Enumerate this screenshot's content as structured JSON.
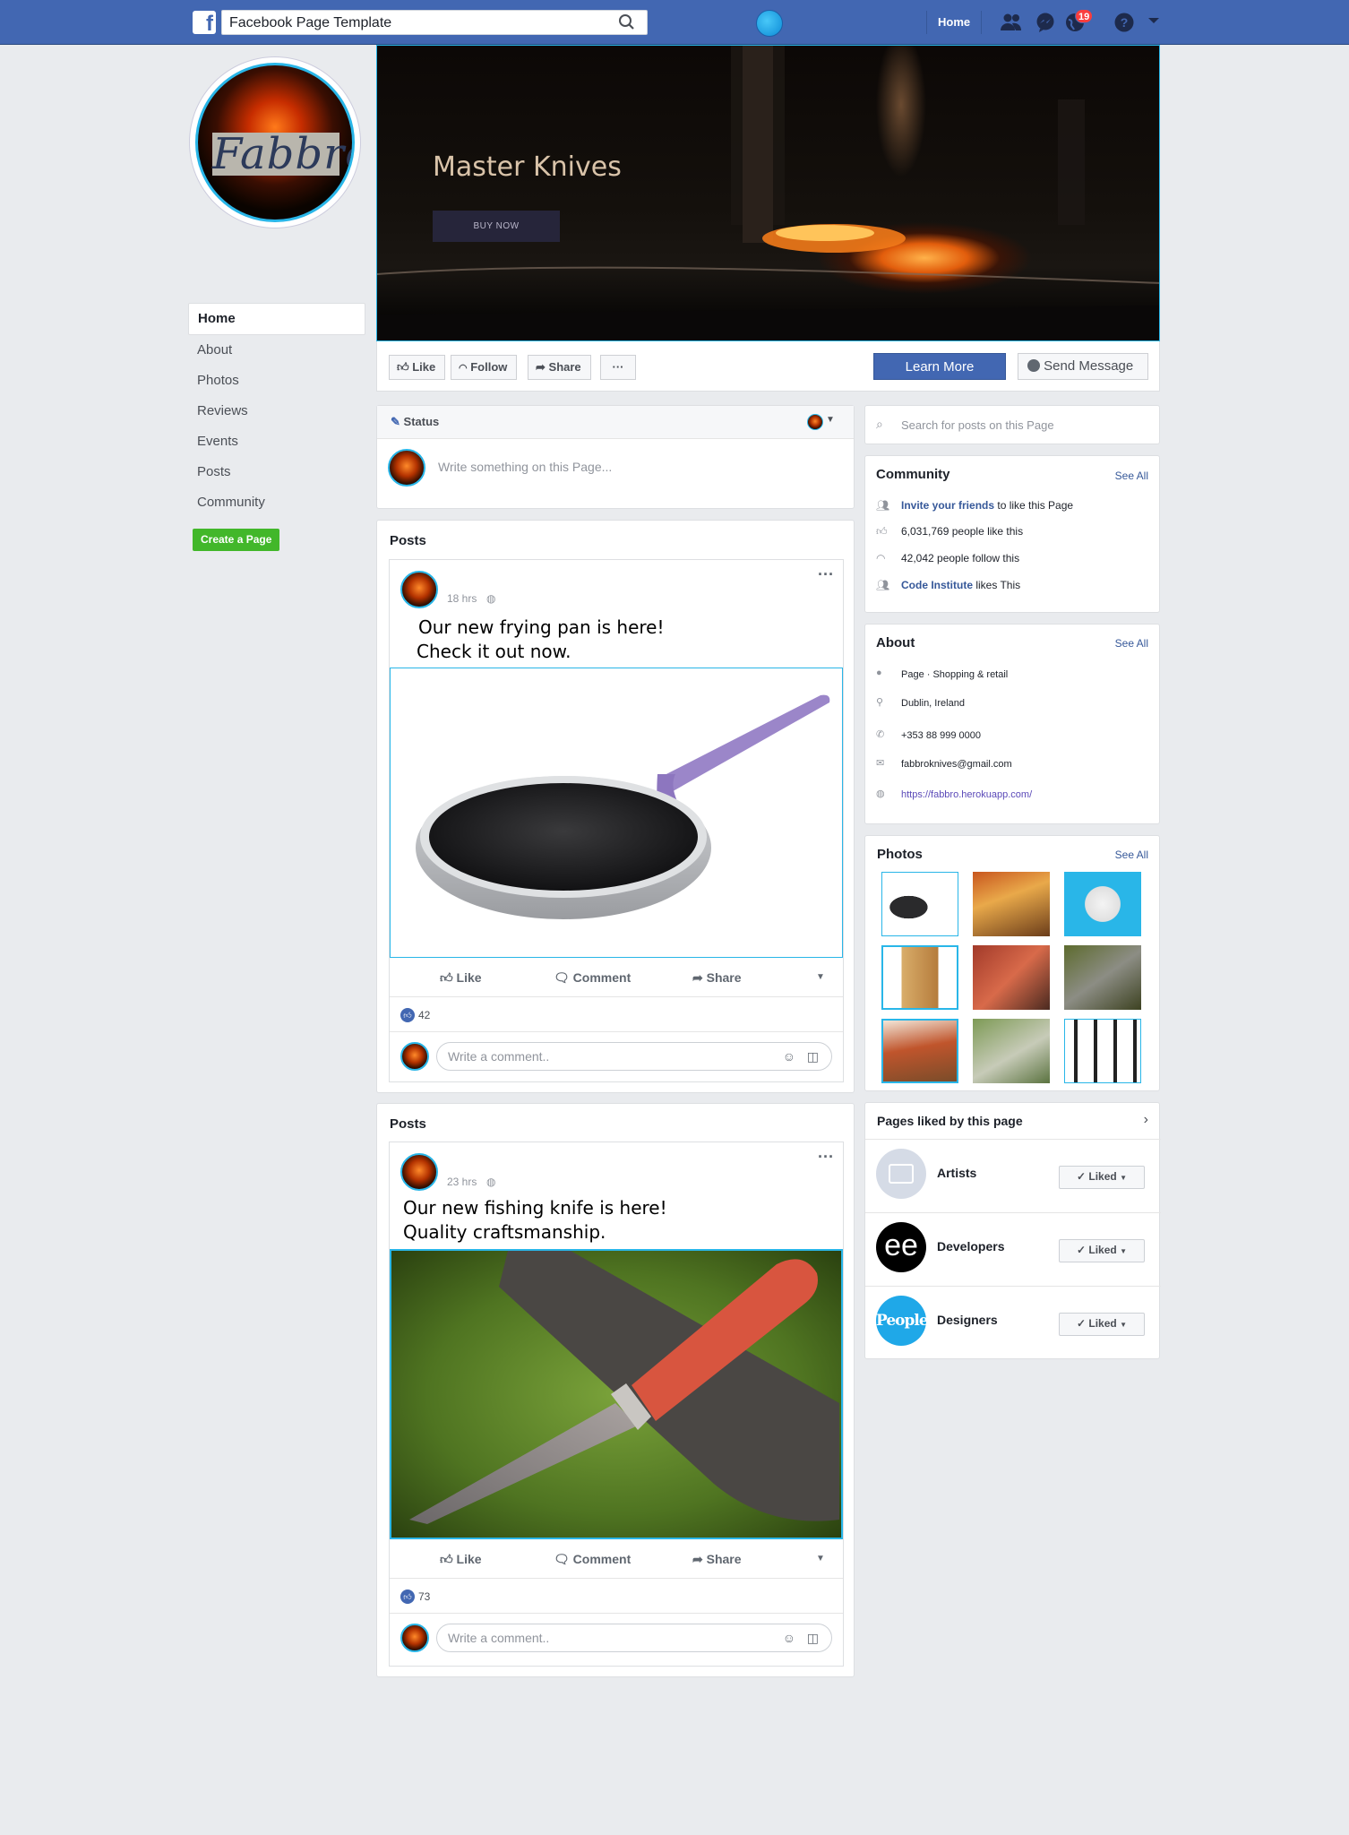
{
  "topbar": {
    "search_value": "Facebook Page Template",
    "home_label": "Home",
    "notification_count": "19",
    "brand_color": "#4267b2"
  },
  "profile": {
    "logo_text": "Fabbro"
  },
  "leftnav": {
    "items": [
      "Home",
      "About",
      "Photos",
      "Reviews",
      "Events",
      "Posts",
      "Community"
    ],
    "create_page": "Create a Page"
  },
  "cover": {
    "title": "Master Knives",
    "button": "BUY NOW"
  },
  "actions": {
    "like": "Like",
    "follow": "Follow",
    "share": "Share",
    "more": "···",
    "learn_more": "Learn More",
    "send_message": "Send Message"
  },
  "status": {
    "tab": "Status",
    "placeholder": "Write something on this Page..."
  },
  "posts": [
    {
      "section_title": "Posts",
      "time": "18 hrs",
      "text_line1": "Our new frying pan is here!",
      "text_line2": "Check it out now.",
      "like": "Like",
      "comment": "Comment",
      "share": "Share",
      "reactions": "42",
      "comment_placeholder": "Write a comment.."
    },
    {
      "section_title": "Posts",
      "time": "23 hrs",
      "text_line1": "Our new fishing knife is here!",
      "text_line2": "Quality craftsmanship.",
      "like": "Like",
      "comment": "Comment",
      "share": "Share",
      "reactions": "73",
      "comment_placeholder": "Write a comment.."
    }
  ],
  "sidebar": {
    "search_placeholder": "Search for posts on this Page",
    "community": {
      "title": "Community",
      "see_all": "See All",
      "invite_link": "Invite your friends",
      "invite_rest": " to like this Page",
      "likes": "6,031,769 people like this",
      "follows": "42,042 people follow this",
      "ci_link": "Code Institute",
      "ci_rest": " likes This"
    },
    "about": {
      "title": "About",
      "see_all": "See All",
      "category": "Page · Shopping & retail",
      "location": "Dublin, Ireland",
      "phone": "+353 88 999  0000",
      "email": "fabbroknives@gmail.com",
      "website": "https://fabbro.herokuapp.com/"
    },
    "photos": {
      "title": "Photos",
      "see_all": "See All"
    },
    "pages_liked": {
      "title": "Pages liked by this page",
      "items": [
        {
          "name": "Artists",
          "button": "Liked"
        },
        {
          "name": "Developers",
          "button": "Liked"
        },
        {
          "name": "Designers",
          "button": "Liked"
        }
      ],
      "developers_logo": "ee",
      "designers_logo": "People"
    }
  }
}
